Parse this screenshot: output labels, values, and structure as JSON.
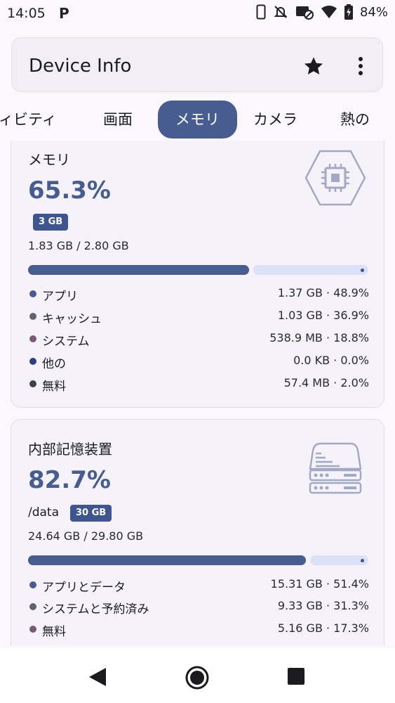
{
  "status_bar": {
    "time": "14:05",
    "notification_icon": "P",
    "battery_percent": "84%",
    "icons": [
      "phone-icon",
      "notifications-off-icon",
      "data-saver-icon",
      "wifi-icon",
      "battery-charging-icon"
    ]
  },
  "app_bar": {
    "title": "Device Info",
    "actions": [
      "star-icon",
      "more-vert-icon"
    ]
  },
  "tabs": [
    {
      "label": "ィビティ",
      "active": false
    },
    {
      "label": "画面",
      "active": false
    },
    {
      "label": "メモリ",
      "active": true
    },
    {
      "label": "カメラ",
      "active": false
    },
    {
      "label": "熱の",
      "active": false
    }
  ],
  "memory_card": {
    "title": "メモリ",
    "percent": "65.3%",
    "used_fraction": 0.653,
    "badge": "3 GB",
    "usage": "1.83 GB / 2.80 GB",
    "icon": "memory-chip-icon",
    "legend": [
      {
        "label": "アプリ",
        "value": "1.37 GB · 48.9%",
        "color": "#4a5a8e"
      },
      {
        "label": "キャッシュ",
        "value": "1.03 GB · 36.9%",
        "color": "#5d6274"
      },
      {
        "label": "システム",
        "value": "538.9 MB · 18.8%",
        "color": "#7a5a78"
      },
      {
        "label": "他の",
        "value": "0.0 KB · 0.0%",
        "color": "#2f3f7c"
      },
      {
        "label": "無料",
        "value": "57.4 MB · 2.0%",
        "color": "#3c3f4e"
      }
    ]
  },
  "storage_card": {
    "title": "内部記憶装置",
    "percent": "82.7%",
    "used_fraction": 0.827,
    "path": "/data",
    "badge": "30 GB",
    "usage": "24.64 GB / 29.80 GB",
    "icon": "storage-drive-icon",
    "legend": [
      {
        "label": "アプリとデータ",
        "value": "15.31 GB · 51.4%",
        "color": "#4a5a8e"
      },
      {
        "label": "システムと予約済み",
        "value": "9.33 GB · 31.3%",
        "color": "#5d6274"
      },
      {
        "label": "無料",
        "value": "5.16 GB · 17.3%",
        "color": "#7a5a78"
      }
    ]
  },
  "nav_bar": {
    "buttons": [
      "back-icon",
      "home-icon",
      "recents-icon"
    ]
  }
}
